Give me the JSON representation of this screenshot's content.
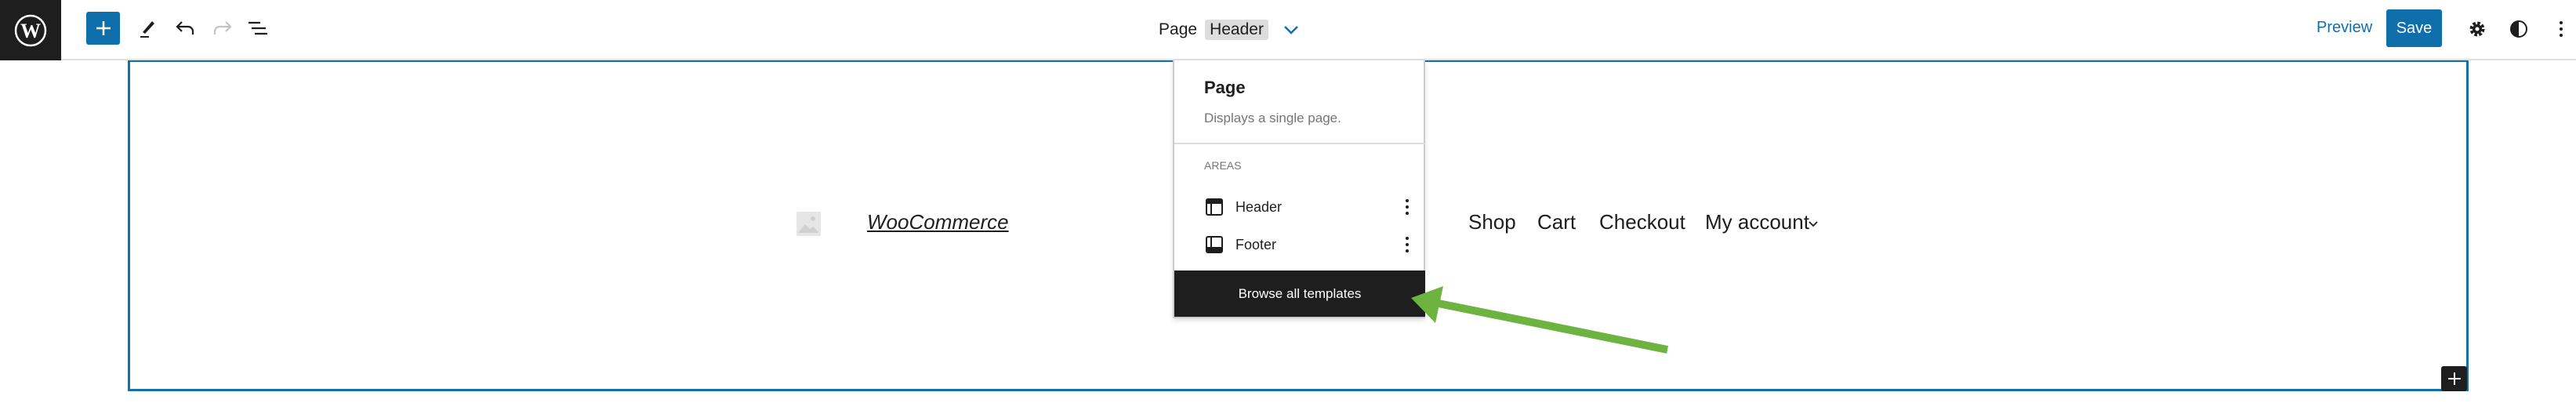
{
  "toolbar": {
    "document_type": "Page",
    "document_part": "Header",
    "preview_label": "Preview",
    "save_label": "Save"
  },
  "popover": {
    "title": "Page",
    "description": "Displays a single page.",
    "section_label": "AREAS",
    "areas": [
      {
        "label": "Header"
      },
      {
        "label": "Footer"
      }
    ],
    "browse_label": "Browse all templates"
  },
  "site": {
    "title": "WooCommerce",
    "nav": [
      "Shop",
      "Cart",
      "Checkout",
      "My account"
    ]
  },
  "colors": {
    "accent": "#0f6fac",
    "arrow": "#6db33f",
    "dark": "#1e1e1e"
  }
}
